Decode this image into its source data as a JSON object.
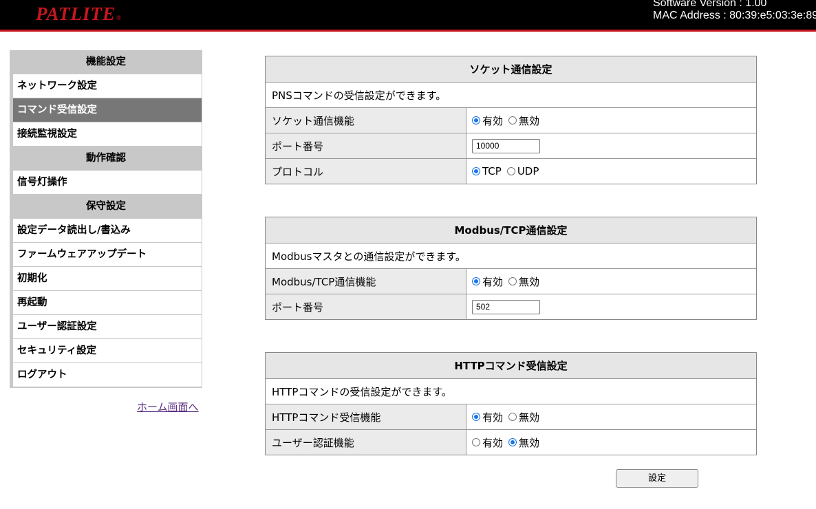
{
  "header": {
    "logo_text": "PATLITE",
    "logo_mark": "®",
    "software_version": "Software Version : 1.00",
    "mac_address": "MAC Address : 80:39:e5:03:3e:89",
    "colors": {
      "background": "#000000",
      "accent": "#c8161d"
    }
  },
  "sidebar": {
    "sections": [
      {
        "heading": "機能設定",
        "items": [
          "ネットワーク設定",
          "コマンド受信設定",
          "接続監視設定"
        ]
      },
      {
        "heading": "動作確認",
        "items": [
          "信号灯操作"
        ]
      },
      {
        "heading": "保守設定",
        "items": [
          "設定データ読出し/書込み",
          "ファームウェアアップデート",
          "初期化",
          "再起動",
          "ユーザー認証設定",
          "セキュリティ設定",
          "ログアウト"
        ]
      }
    ],
    "active_item": "コマンド受信設定",
    "home_link": "ホーム画面へ"
  },
  "socket": {
    "title": "ソケット通信設定",
    "description": "PNSコマンドの受信設定ができます。",
    "function_label": "ソケット通信機能",
    "function_on": "有効",
    "function_off": "無効",
    "function_selected": "有効",
    "port_label": "ポート番号",
    "port_value": "10000",
    "protocol_label": "プロトコル",
    "protocol_tcp": "TCP",
    "protocol_udp": "UDP",
    "protocol_selected": "TCP"
  },
  "modbus": {
    "title": "Modbus/TCP通信設定",
    "description": "Modbusマスタとの通信設定ができます。",
    "function_label": "Modbus/TCP通信機能",
    "function_on": "有効",
    "function_off": "無効",
    "function_selected": "有効",
    "port_label": "ポート番号",
    "port_value": "502"
  },
  "http": {
    "title": "HTTPコマンド受信設定",
    "description": "HTTPコマンドの受信設定ができます。",
    "function_label": "HTTPコマンド受信機能",
    "function_on": "有効",
    "function_off": "無効",
    "function_selected": "有効",
    "auth_label": "ユーザー認証機能",
    "auth_on": "有効",
    "auth_off": "無効",
    "auth_selected": "無効"
  },
  "submit_label": "設定"
}
